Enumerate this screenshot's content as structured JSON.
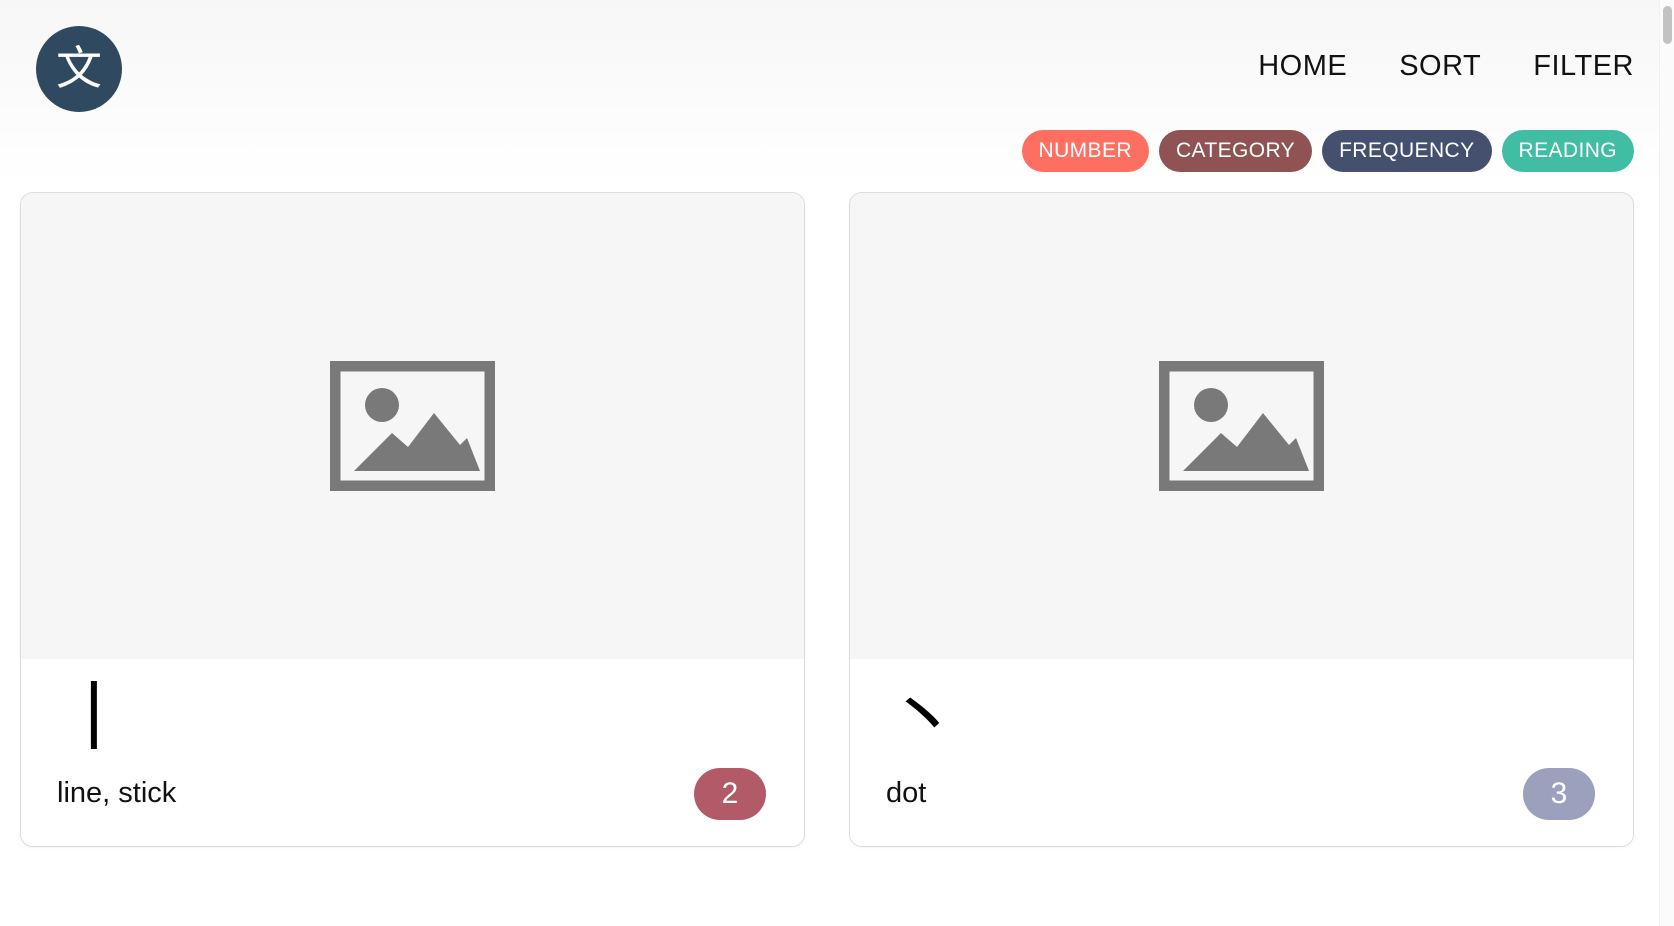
{
  "header": {
    "logo": {
      "glyph": "文",
      "icon_name": "app-logo-kanji",
      "background_color": "#2f4a60"
    },
    "nav_items": [
      {
        "label": "HOME"
      },
      {
        "label": "SORT"
      },
      {
        "label": "FILTER"
      }
    ],
    "pills": [
      {
        "label": "NUMBER",
        "color": "#fd6f61"
      },
      {
        "label": "CATEGORY",
        "color": "#8f5353"
      },
      {
        "label": "FREQUENCY",
        "color": "#44506e"
      },
      {
        "label": "READING",
        "color": "#41bda3"
      }
    ]
  },
  "cards": [
    {
      "image_placeholder_icon": "image-placeholder-icon",
      "glyph": "丨",
      "meaning": "line, stick",
      "count": "2",
      "count_color": "#b35a68"
    },
    {
      "image_placeholder_icon": "image-placeholder-icon",
      "glyph": "丶",
      "meaning": "dot",
      "count": "3",
      "count_color": "#9ba0bd"
    }
  ],
  "scrollbar": {
    "thumb_label": ""
  }
}
